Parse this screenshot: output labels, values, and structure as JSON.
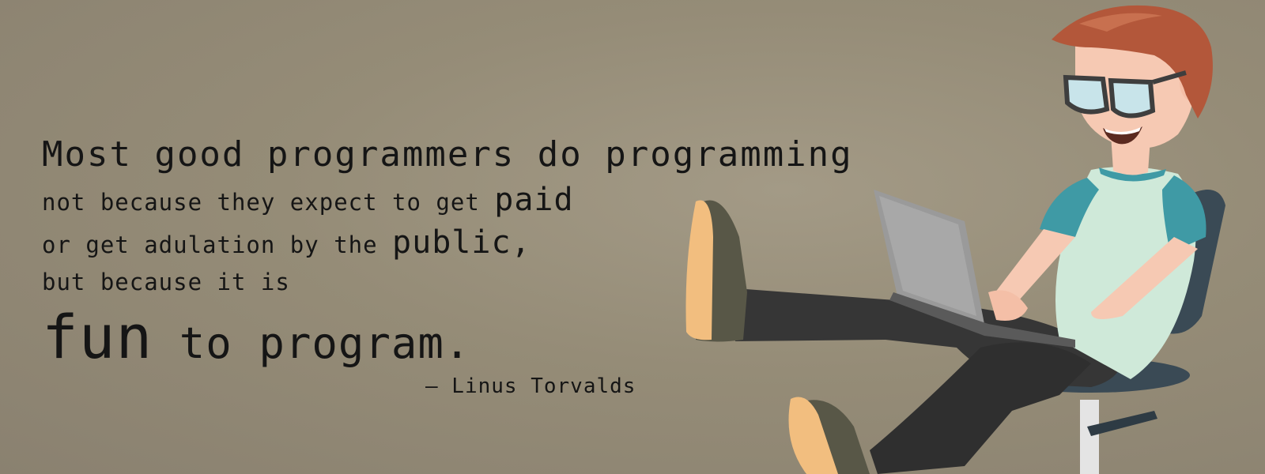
{
  "quote": {
    "line1": "Most good programmers do programming",
    "line2_prefix": "not because they expect to get ",
    "line2_emph": "paid",
    "line3_prefix": "or get adulation by the ",
    "line3_emph": "public,",
    "line4": "but because it is",
    "line5_emph": "fun",
    "line5_rest": " to program."
  },
  "author": "– Linus Torvalds",
  "colors": {
    "background": "#958c77",
    "text": "#151515",
    "hair": "#b3573a",
    "shirt": "#cfe9d9",
    "sleeves": "#3f9aa5",
    "skin": "#f6c9b3",
    "pants": "#363636",
    "shoes": "#585747",
    "soles": "#f2be7f",
    "laptop": "#9a9a9a",
    "chair": "#3a4a55"
  }
}
